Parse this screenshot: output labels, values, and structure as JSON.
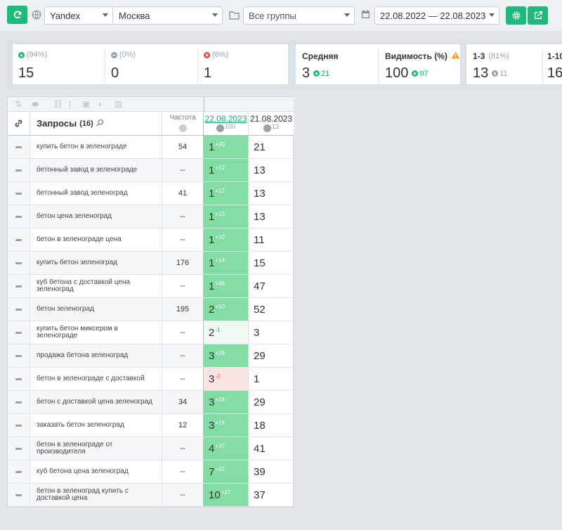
{
  "toolbar": {
    "search_engine": "Yandex",
    "region": "Москва",
    "groups": "Все группы",
    "date_range": "22.08.2022 — 22.08.2023"
  },
  "summary": {
    "cards": [
      {
        "pct": "(94%)",
        "value": "15",
        "icon": "arrow-up-green-icon"
      },
      {
        "pct": "(0%)",
        "value": "0",
        "icon": "minus-gray-icon"
      },
      {
        "pct": "(6%)",
        "value": "1",
        "icon": "arrow-down-red-icon"
      }
    ],
    "average": {
      "title": "Средняя",
      "value": "3",
      "delta": "21"
    },
    "visibility": {
      "title": "Видимость (%)",
      "value": "100",
      "delta": "97"
    },
    "top3": {
      "title": "1-3",
      "pct": "(81%)",
      "value": "13",
      "delta": "11"
    },
    "top10": {
      "title": "1-10",
      "value": "16"
    }
  },
  "colors": {
    "accent": "#1fb97c",
    "green_cell": "#82dca4",
    "red_cell": "#fbe4e1"
  },
  "table": {
    "queries_label": "Запросы",
    "queries_count": "(16)",
    "freq_label": "Частота",
    "date1": "22.08.2023",
    "date1_sub": "100",
    "date2": "21.08.2023",
    "date2_sub": "13",
    "rows": [
      {
        "q": "купить бетон в зеленограде",
        "freq": "54",
        "pos": "1",
        "delta": "+20",
        "prev": "21",
        "style": "green"
      },
      {
        "q": "бетонный завод в зеленограде",
        "freq": "--",
        "pos": "1",
        "delta": "+12",
        "prev": "13",
        "style": "green"
      },
      {
        "q": "бетонный завод зеленоград",
        "freq": "41",
        "pos": "1",
        "delta": "+12",
        "prev": "13",
        "style": "green"
      },
      {
        "q": "бетон цена зеленоград",
        "freq": "--",
        "pos": "1",
        "delta": "+12",
        "prev": "13",
        "style": "green"
      },
      {
        "q": "бетон в зеленограде цена",
        "freq": "--",
        "pos": "1",
        "delta": "+10",
        "prev": "11",
        "style": "green"
      },
      {
        "q": "купить бетон зеленоград",
        "freq": "176",
        "pos": "1",
        "delta": "+14",
        "prev": "15",
        "style": "green"
      },
      {
        "q": "куб бетона с доставкой цена зеленоград",
        "freq": "--",
        "pos": "1",
        "delta": "+46",
        "prev": "47",
        "style": "green"
      },
      {
        "q": "бетон зеленоград",
        "freq": "195",
        "pos": "2",
        "delta": "+50",
        "prev": "52",
        "style": "green"
      },
      {
        "q": "купить бетон миксером в зеленограде",
        "freq": "--",
        "pos": "2",
        "delta": "-1",
        "prev": "3",
        "style": "pale"
      },
      {
        "q": "продажа бетона зеленоград",
        "freq": "--",
        "pos": "3",
        "delta": "+26",
        "prev": "29",
        "style": "green"
      },
      {
        "q": "бетон в зеленограде с доставкой",
        "freq": "--",
        "pos": "3",
        "delta": "-2",
        "prev": "1",
        "style": "red"
      },
      {
        "q": "бетон с доставкой цена зеленоград",
        "freq": "34",
        "pos": "3",
        "delta": "+26",
        "prev": "29",
        "style": "green"
      },
      {
        "q": "заказать бетон зеленоград",
        "freq": "12",
        "pos": "3",
        "delta": "+15",
        "prev": "18",
        "style": "green"
      },
      {
        "q": "бетон в зеленограде от производителя",
        "freq": "--",
        "pos": "4",
        "delta": "+37",
        "prev": "41",
        "style": "green"
      },
      {
        "q": "куб бетона цена зеленоград",
        "freq": "--",
        "pos": "7",
        "delta": "+32",
        "prev": "39",
        "style": "green"
      },
      {
        "q": "бетон в зеленоград купить с доставкой цена",
        "freq": "--",
        "pos": "10",
        "delta": "+27",
        "prev": "37",
        "style": "green"
      }
    ]
  }
}
